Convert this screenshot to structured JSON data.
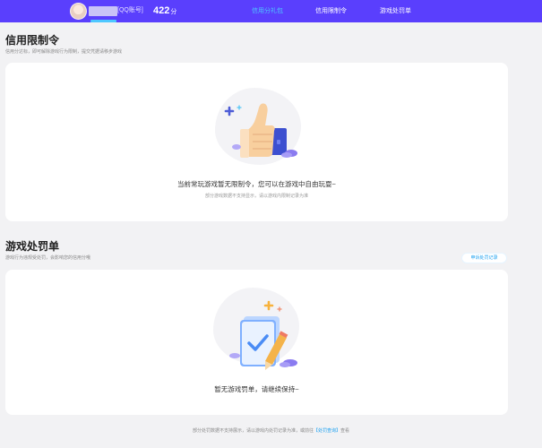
{
  "topbar": {
    "qq_suffix": "[QQ账号]",
    "score_value": "422",
    "score_unit": "分",
    "tabs": [
      {
        "label": "信用分礼包",
        "active": true
      },
      {
        "label": "信用限制令",
        "active": false
      },
      {
        "label": "游戏处罚单",
        "active": false
      }
    ],
    "bg_color": "#5a3ffd",
    "active_color": "#4ec8ff"
  },
  "credit_limit": {
    "title": "信用限制令",
    "subtitle": "信用分达标，即可解除游戏行为限制，提交凭据请移步游戏",
    "empty_text": "当前常玩游戏暂无限制令，您可以在游戏中自由玩耍~",
    "empty_sub": "部分游戏数据不支持显示，请以游戏内限制记录为准",
    "icon": "thumbs-up-icon"
  },
  "penalty": {
    "title": "游戏处罚单",
    "subtitle": "游戏行为违规受处罚，会影响您的信用分哦",
    "link_label": "申诉处罚记录",
    "empty_text": "暂无游戏罚单，请继续保持~",
    "icon": "clipboard-check-icon"
  },
  "footer": {
    "text_before": "部分处罚数据不支持展示，请以游戏内处罚记录为准，或前往",
    "link_label": "【处罚查询】",
    "text_after": "查看"
  }
}
